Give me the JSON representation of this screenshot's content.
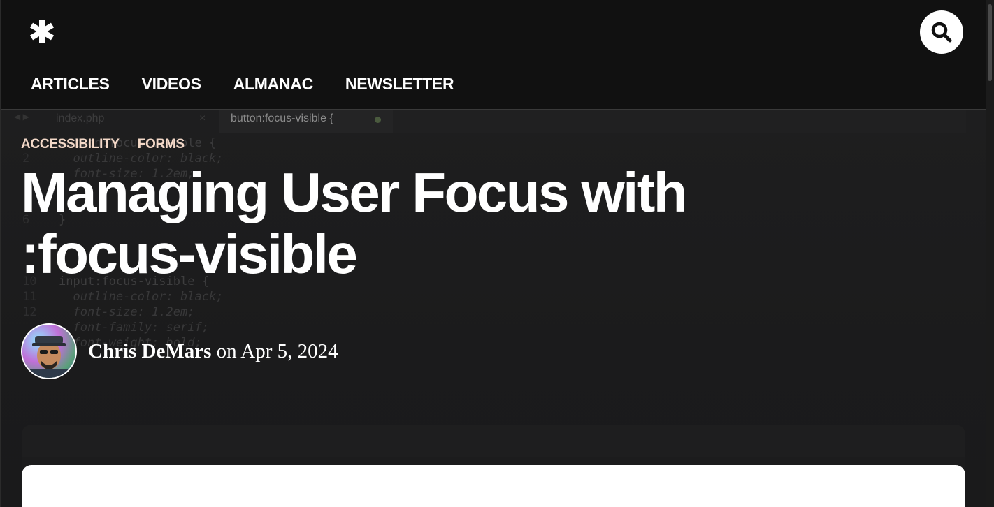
{
  "header": {
    "logo_icon": "asterisk-logo-icon",
    "search_icon": "search-icon",
    "nav": [
      {
        "label": "ARTICLES"
      },
      {
        "label": "VIDEOS"
      },
      {
        "label": "ALMANAC"
      },
      {
        "label": "NEWSLETTER"
      }
    ]
  },
  "hero_background": {
    "editor_tabs": [
      {
        "label": "index.php"
      },
      {
        "label": "button:focus-visible {"
      }
    ],
    "code_lines": [
      {
        "num": "",
        "text": "button:focus-visible {"
      },
      {
        "num": "2",
        "text": "  outline-color: black;"
      },
      {
        "num": "",
        "text": "  font-size: 1.2em;"
      },
      {
        "num": "6",
        "text": "}"
      },
      {
        "num": "10",
        "text": "input:focus-visible {"
      },
      {
        "num": "11",
        "text": "  outline-color: black;"
      },
      {
        "num": "12",
        "text": "  font-size: 1.2em;"
      },
      {
        "num": "",
        "text": "  font-family: serif;"
      },
      {
        "num": "",
        "text": "  font-weight: bold;"
      }
    ]
  },
  "article": {
    "tags": [
      "ACCESSIBILITY",
      "FORMS"
    ],
    "title": "Managing User Focus with :focus-visible",
    "author": "Chris DeMars",
    "date_prefix": "on",
    "date": "Apr 5, 2024"
  },
  "colors": {
    "header_bg": "#111111",
    "tag_color": "#f4d9c8",
    "title_color": "#ffffff"
  }
}
